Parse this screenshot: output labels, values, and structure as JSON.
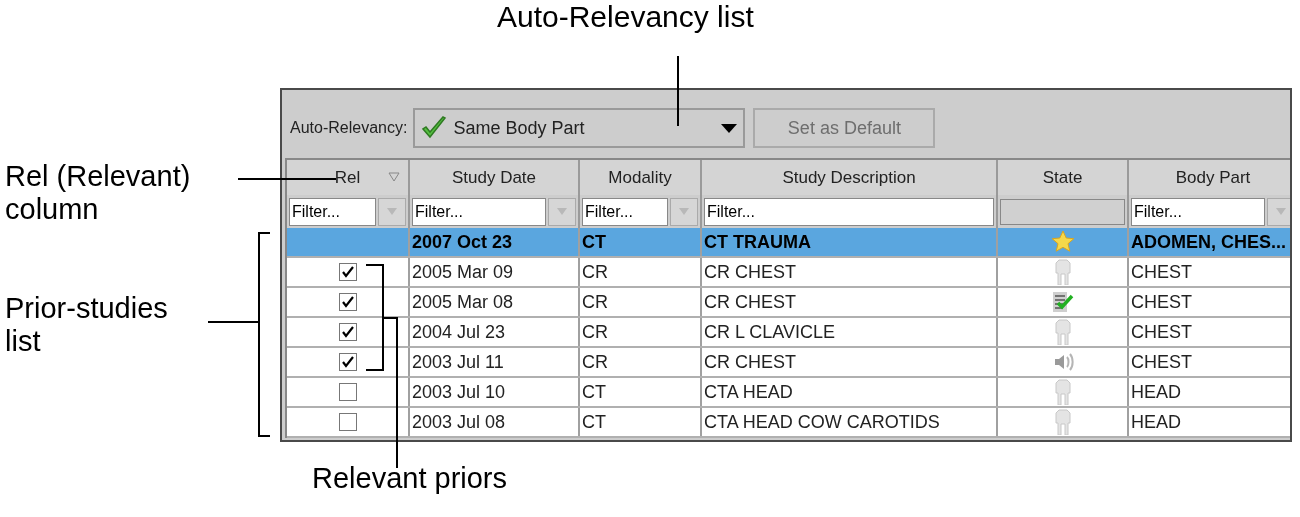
{
  "callouts": {
    "auto_relevancy_list": "Auto-Relevancy list",
    "rel_column": "Rel (Relevant) column",
    "prior_studies_list": "Prior-studies list",
    "relevant_priors": "Relevant priors"
  },
  "toolbar": {
    "label": "Auto-Relevancy:",
    "dropdown": {
      "value": "Same Body Part"
    },
    "button": {
      "label": "Set as Default",
      "disabled": true
    }
  },
  "columns": [
    {
      "label": "Rel",
      "sort_indicator": true,
      "filter": {
        "placeholder": "Filter..."
      }
    },
    {
      "label": "Study Date",
      "sort_indicator": false,
      "filter": {
        "placeholder": "Filter..."
      }
    },
    {
      "label": "Modality",
      "sort_indicator": false,
      "filter": {
        "placeholder": "Filter..."
      }
    },
    {
      "label": "Study Description",
      "sort_indicator": false,
      "filter": {
        "placeholder": "Filter...",
        "dropdown": false
      }
    },
    {
      "label": "State",
      "sort_indicator": false
    },
    {
      "label": "Body Part",
      "sort_indicator": false,
      "filter": {
        "placeholder": "Filter..."
      }
    }
  ],
  "rows": [
    {
      "selected": true,
      "date": "2007 Oct 23",
      "modality": "CT",
      "description": "CT TRAUMA",
      "state": {
        "kind": "star"
      },
      "body_part": "ADOMEN, CHES..."
    },
    {
      "selected": false,
      "checked": true,
      "date": "2005 Mar 09",
      "modality": "CR",
      "description": "CR CHEST",
      "state": {
        "kind": "figure"
      },
      "body_part": "CHEST"
    },
    {
      "selected": false,
      "checked": true,
      "date": "2005 Mar 08",
      "modality": "CR",
      "description": "CR CHEST",
      "state": {
        "kind": "report"
      },
      "body_part": "CHEST"
    },
    {
      "selected": false,
      "checked": true,
      "date": "2004 Jul 23",
      "modality": "CR",
      "description": "CR L CLAVICLE",
      "state": {
        "kind": "figure"
      },
      "body_part": "CHEST"
    },
    {
      "selected": false,
      "checked": true,
      "date": "2003 Jul 11",
      "modality": "CR",
      "description": "CR CHEST",
      "state": {
        "kind": "audio"
      },
      "body_part": "CHEST"
    },
    {
      "selected": false,
      "checked": false,
      "date": "2003 Jul 10",
      "modality": "CT",
      "description": "CTA HEAD",
      "state": {
        "kind": "figure"
      },
      "body_part": "HEAD"
    },
    {
      "selected": false,
      "checked": false,
      "date": "2003 Jul 08",
      "modality": "CT",
      "description": "CTA HEAD COW CAROTIDS",
      "state": {
        "kind": "figure"
      },
      "body_part": "HEAD"
    }
  ]
}
